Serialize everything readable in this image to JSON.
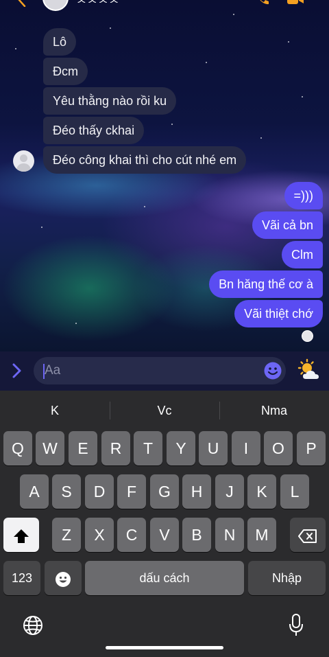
{
  "header": {
    "contact_name": "ᄉᄉᄉᄉ",
    "back_icon": "chevron-left-icon",
    "call_icon": "phone-icon",
    "video_icon": "video-icon"
  },
  "messages": {
    "incoming": [
      "Lô",
      "Đcm",
      "Yêu thằng nào rồi ku",
      "Đéo thấy ckhai",
      "Đéo công khai thì cho cút nhé em"
    ],
    "outgoing": [
      "=)))",
      "Vãi cả bn",
      "Clm",
      "Bn hăng thế cơ à",
      "Vãi thiệt chớ"
    ]
  },
  "composer": {
    "placeholder": "Aa",
    "expand_icon": "chevron-right-icon",
    "emoji_icon": "smiley-icon",
    "weather_icon": "sun-behind-cloud-icon"
  },
  "keyboard": {
    "suggestions": [
      "K",
      "Vc",
      "Nma"
    ],
    "row1": [
      "Q",
      "W",
      "E",
      "R",
      "T",
      "Y",
      "U",
      "I",
      "O",
      "P"
    ],
    "row2": [
      "A",
      "S",
      "D",
      "F",
      "G",
      "H",
      "J",
      "K",
      "L"
    ],
    "row3": [
      "Z",
      "X",
      "C",
      "V",
      "B",
      "N",
      "M"
    ],
    "numbers_label": "123",
    "space_label": "dấu cách",
    "return_label": "Nhập",
    "shift_icon": "shift-icon",
    "delete_icon": "backspace-icon",
    "emoji_icon": "emoji-icon",
    "globe_icon": "globe-icon",
    "mic_icon": "microphone-icon"
  },
  "colors": {
    "outgoing_bubble": "#5a4cf2",
    "incoming_bubble": "#262a47",
    "accent": "#f5a021"
  }
}
